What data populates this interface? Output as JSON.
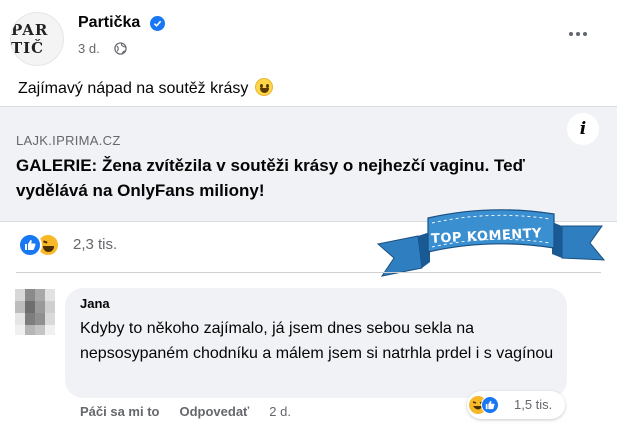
{
  "post": {
    "page_name": "Partička",
    "avatar_text": "PAR TIČ",
    "time": "3 d.",
    "text": "Zajímavý nápad na soutěž krásy",
    "icons": [
      "verified-badge-icon",
      "globe-icon",
      "more-options-icon",
      "smile-emoji-icon"
    ]
  },
  "link": {
    "domain": "LAJK.IPRIMA.CZ",
    "title": "GALERIE: Žena zvítězila v soutěži krásy o nejhezčí vaginu. Teď vydělává na OnlyFans miliony!",
    "info_icon": "i"
  },
  "reactions": {
    "count": "2,3 tis.",
    "types": [
      "like",
      "haha"
    ]
  },
  "badge": {
    "label": "TOP KOMENTY",
    "color": "#3a8fd0"
  },
  "comment": {
    "author": "Jana",
    "text": "Kdyby to někoho zajímalo, já jsem dnes sebou sekla na nepsosypaném chodníku a málem jsem si natrhla prdel i s vagínou",
    "actions": {
      "like": "Páči sa mi to",
      "reply": "Odpovedať",
      "time": "2 d."
    },
    "reaction_count": "1,5 tis."
  },
  "colors": {
    "accent": "#1877f2",
    "secondary_text": "#65676b",
    "card_bg": "#f0f2f5"
  }
}
